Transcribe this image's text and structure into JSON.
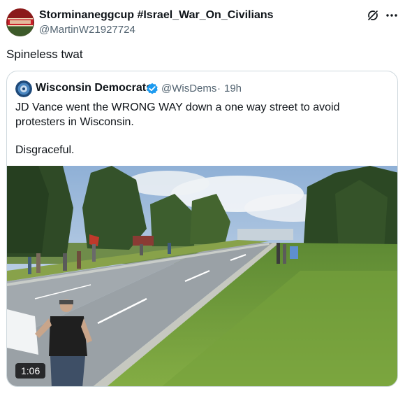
{
  "post": {
    "author": {
      "display_name": "Storminaneggcup #Israel_War_On_Civilians",
      "handle": "@MartinW21927724"
    },
    "text": "Spineless twat",
    "icons": {
      "grok": "grok-icon",
      "more": "more-icon"
    }
  },
  "quoted_post": {
    "author": {
      "display_name": "Wisconsin Democrats",
      "handle": "@WisDems",
      "verified": true
    },
    "separator": "·",
    "time": "19h",
    "text_line_1": "JD Vance went the WRONG WAY down a one way street to avoid protesters in Wisconsin.",
    "text_line_2": "Disgraceful.",
    "video": {
      "duration": "1:06"
    }
  },
  "colors": {
    "text_primary": "#0f1419",
    "text_secondary": "#536471",
    "border": "#cfd9de",
    "verified_blue": "#1d9bf0"
  }
}
